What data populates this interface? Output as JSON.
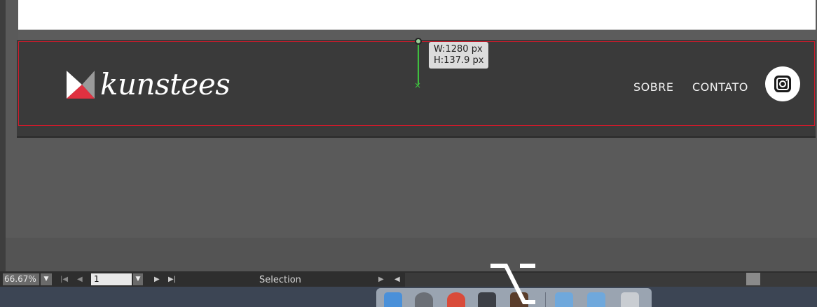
{
  "header": {
    "brand": "kunstees",
    "nav_items": [
      "SOBRE",
      "CONTATO"
    ],
    "social_icon": "instagram-icon"
  },
  "measure_tooltip": {
    "width": "W:1280 px",
    "height": "H:137.9 px"
  },
  "status_bar": {
    "zoom": "66.67%",
    "page": "1",
    "current_tool": "Selection"
  },
  "dock": {
    "icons": [
      "finder-icon",
      "system-preferences-icon",
      "chrome-icon",
      "imovie-icon",
      "app-icon",
      "folder-icon",
      "downloads-icon",
      "trash-icon"
    ]
  },
  "colors": {
    "header_bg": "#3a3a3a",
    "selection_outline": "#d11a2a",
    "measure_guide": "#3fbf3f",
    "logo_red": "#e03140"
  }
}
